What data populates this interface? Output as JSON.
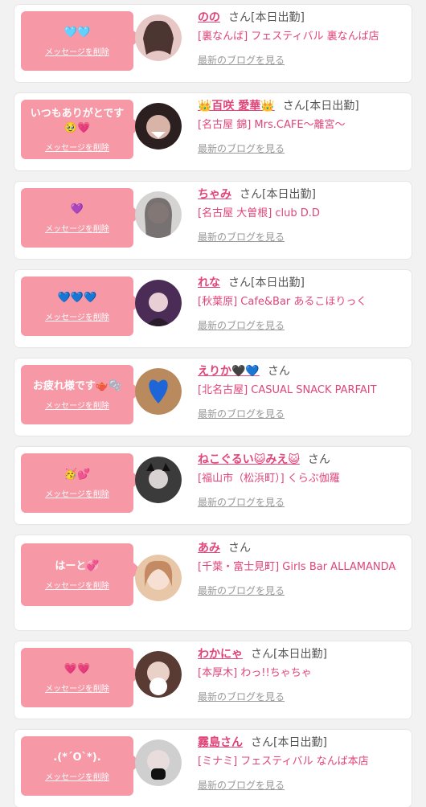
{
  "items": [
    {
      "message": "🩵🩵",
      "delete_label": "メッセージを削除",
      "name": "のの",
      "suffix": "さん[本日出勤]",
      "shop": "[裏なんば] フェスティバル 裏なんば店",
      "blog_link": "最新のブログを見る"
    },
    {
      "message": "いつもありがとです🥹💗",
      "delete_label": "メッセージを削除",
      "name": "👑百咲 愛華👑",
      "suffix": "さん[本日出勤]",
      "shop": "[名古屋 錦] Mrs.CAFE〜離宮〜",
      "blog_link": "最新のブログを見る"
    },
    {
      "message": "💜",
      "delete_label": "メッセージを削除",
      "name": "ちゃみ",
      "suffix": "さん[本日出勤]",
      "shop": "[名古屋 大曽根] club D.D",
      "blog_link": "最新のブログを見る"
    },
    {
      "message": "💙💙💙",
      "delete_label": "メッセージを削除",
      "name": "れな",
      "suffix": "さん[本日出勤]",
      "shop": "[秋葉原] Cafe&Bar あるこほりっく",
      "blog_link": "最新のブログを見る"
    },
    {
      "message": "お疲れ様です🫖🫧",
      "delete_label": "メッセージを削除",
      "name": "えりか🖤💙",
      "suffix": "さん",
      "shop": "[北名古屋] CASUAL SNACK PARFAIT",
      "blog_link": "最新のブログを見る"
    },
    {
      "message": "🥳💕",
      "delete_label": "メッセージを削除",
      "name": "ねこぐるい😺みえ😺",
      "suffix": "さん",
      "shop": "[福山市（松浜町）] くらぶ伽羅",
      "blog_link": "最新のブログを見る"
    },
    {
      "message": "はーと💞",
      "delete_label": "メッセージを削除",
      "name": "あみ",
      "suffix": "さん",
      "shop": "[千葉・富士見町] Girls Bar ALLAMANDA",
      "blog_link": "最新のブログを見る"
    },
    {
      "message": "💗💗",
      "delete_label": "メッセージを削除",
      "name": "わかにゃ",
      "suffix": "さん[本日出勤]",
      "shop": "[本厚木] わっ!!ちゃちゃ",
      "blog_link": "最新のブログを見る"
    },
    {
      "message": ".(*´O`*).",
      "delete_label": "メッセージを削除",
      "name": "霧島さん",
      "suffix": "さん[本日出勤]",
      "shop": "[ミナミ] フェスティバル なんば本店",
      "blog_link": "最新のブログを見る"
    }
  ],
  "colors": {
    "bubble": "#f798a6",
    "accent": "#e0457a"
  }
}
